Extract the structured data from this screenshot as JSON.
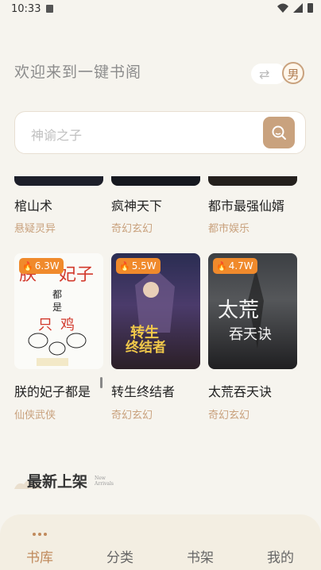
{
  "status_bar": {
    "time": "10:33"
  },
  "header": {
    "welcome": "欢迎来到一键书阁",
    "gender_label": "男"
  },
  "search": {
    "placeholder": "神谕之子"
  },
  "top_row": [
    {
      "title": "棺山术",
      "genre": "悬疑灵异"
    },
    {
      "title": "疯神天下",
      "genre": "奇幻玄幻"
    },
    {
      "title": "都市最强仙婿",
      "genre": "都市娱乐"
    }
  ],
  "second_row": [
    {
      "title": "朕的妃子都是",
      "genre": "仙侠武侠",
      "heat": "6.3W",
      "cover_text": [
        "朕",
        "妃子",
        "都",
        "是",
        "只",
        "鸡"
      ]
    },
    {
      "title": "转生终结者",
      "genre": "奇幻玄幻",
      "heat": "5.5W",
      "cover_text": [
        "转生",
        "终结者"
      ]
    },
    {
      "title": "太荒吞天诀",
      "genre": "奇幻玄幻",
      "heat": "4.7W",
      "cover_text": [
        "太荒",
        "吞天诀"
      ]
    }
  ],
  "section": {
    "title": "最新上架",
    "subtitle_line1": "New",
    "subtitle_line2": "Arrivals"
  },
  "tabs": [
    {
      "label": "书库",
      "active": true
    },
    {
      "label": "分类",
      "active": false
    },
    {
      "label": "书架",
      "active": false
    },
    {
      "label": "我的",
      "active": false
    }
  ],
  "colors": {
    "accent": "#c9a27e",
    "heat": "#f08a2c",
    "background": "#f6f4ee"
  }
}
